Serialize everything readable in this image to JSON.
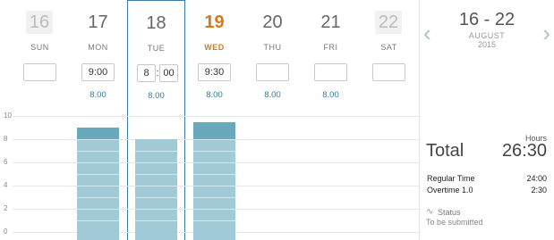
{
  "week": {
    "days": [
      {
        "num": "16",
        "name": "SUN",
        "time": "",
        "total": ""
      },
      {
        "num": "17",
        "name": "MON",
        "time": "9:00",
        "total": "8.00"
      },
      {
        "num": "18",
        "name": "TUE",
        "time_hours": "8",
        "time_minutes": "00",
        "total": "8.00"
      },
      {
        "num": "19",
        "name": "WED",
        "time": "9:30",
        "total": "8.00"
      },
      {
        "num": "20",
        "name": "THU",
        "time": "",
        "total": "8.00"
      },
      {
        "num": "21",
        "name": "FRI",
        "time": "",
        "total": "8.00"
      },
      {
        "num": "22",
        "name": "SAT",
        "time": "",
        "total": ""
      }
    ],
    "selected_day": "TUE",
    "today": "WED"
  },
  "chart_data": {
    "type": "bar",
    "y_ticks": [
      "10",
      "8",
      "6",
      "4",
      "2",
      "0"
    ],
    "ylim": [
      0,
      10
    ],
    "categories": [
      "SUN",
      "MON",
      "TUE",
      "WED",
      "THU",
      "FRI",
      "SAT"
    ],
    "series": [
      {
        "values": [
          0,
          8,
          8,
          8,
          0,
          0,
          0
        ]
      },
      {
        "values": [
          0,
          1,
          0,
          1.5,
          0,
          0,
          0
        ]
      }
    ],
    "colors": {
      "regular": "#9fcad6",
      "overtime": "#6aa9bb"
    }
  },
  "summary": {
    "range": "16 - 22",
    "month": "AUGUST",
    "year": "2015",
    "hours_label": "Hours",
    "total_label": "Total",
    "total_value": "26:30",
    "breakdown": [
      {
        "label": "Regular Time",
        "value": "24:00"
      },
      {
        "label": "Overtime 1.0",
        "value": "2:30"
      }
    ],
    "status_label": "Status",
    "status_value": "To be submitted",
    "prev_icon": "chevron-left-icon",
    "next_icon": "chevron-right-icon"
  }
}
